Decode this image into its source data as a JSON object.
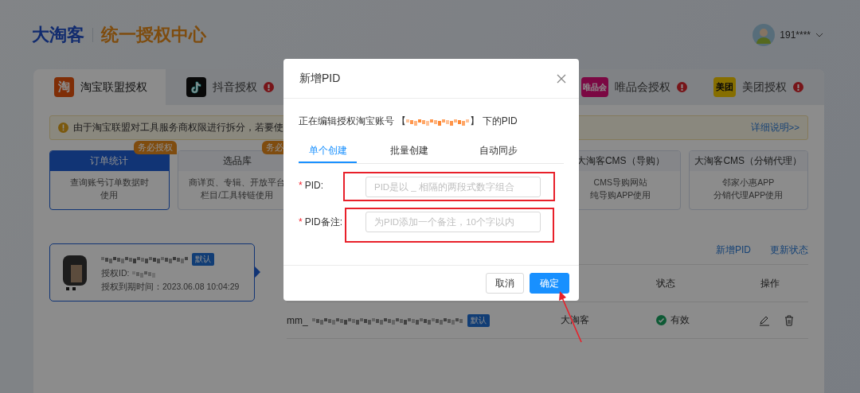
{
  "header": {
    "brand": "大淘客",
    "title": "统一授权中心",
    "user": {
      "name": "191****"
    }
  },
  "tabs": [
    {
      "label": "淘宝联盟授权",
      "selected": true,
      "alert": false,
      "icon": {
        "kind": "taobao",
        "text": "淘"
      }
    },
    {
      "label": "抖音授权",
      "selected": false,
      "alert": true,
      "icon": {
        "kind": "douyin"
      }
    },
    {
      "kind": "hidden"
    },
    {
      "kind": "hidden"
    },
    {
      "label": "唯品会授权",
      "selected": false,
      "alert": true,
      "icon": {
        "kind": "vip",
        "text": "唯品会"
      }
    },
    {
      "label": "美团授权",
      "selected": false,
      "alert": true,
      "icon": {
        "kind": "meituan",
        "text": "美团"
      }
    }
  ],
  "notice": {
    "text": "由于淘宝联盟对工具服务商权限进行拆分，若要使",
    "link": "详细说明>>"
  },
  "features": [
    {
      "title": "订单统计",
      "selected": true,
      "badge": "务必授权",
      "desc": [
        "查询账号订单数据时",
        "使用"
      ]
    },
    {
      "title": "选品库",
      "selected": false,
      "badge": "务必",
      "desc": [
        "商详页、专辑、开放平台",
        "栏目/工具转链使用"
      ]
    },
    {
      "kind": "hidden"
    },
    {
      "kind": "hidden"
    },
    {
      "title": "大淘客CMS（导购）",
      "selected": false,
      "desc": [
        "CMS导购网站",
        "纯导购APP使用"
      ]
    },
    {
      "title": "大淘客CMS（分销代理）",
      "selected": false,
      "desc": [
        "邻家小惠APP",
        "分销代理APP使用"
      ]
    }
  ],
  "account": {
    "tag": "默认",
    "id_label": "授权ID:",
    "expiry": "授权到期时间：2023.06.08 10:04:29",
    "selected": true
  },
  "actions": [
    "新增PID",
    "更新状态"
  ],
  "table": {
    "columns": [
      "",
      "",
      "状态",
      "操作"
    ],
    "rows": [
      {
        "pid_prefix": "mm_",
        "tag": "默认",
        "source": "大淘客",
        "status": "有效",
        "valid": true
      }
    ]
  },
  "dialog": {
    "title": "新增PID",
    "intro_before": "正在编辑授权淘宝账号 【",
    "intro_after": "】 下的PID",
    "tabs": [
      {
        "label": "单个创建",
        "selected": true
      },
      {
        "label": "批量创建",
        "selected": false
      },
      {
        "label": "自动同步",
        "selected": false
      }
    ],
    "fields": [
      {
        "label": "PID:",
        "required_mark": "*",
        "placeholder": "PID是以 _ 相隔的两段式数字组合"
      },
      {
        "label": "PID备注:",
        "required_mark": "*",
        "placeholder": "为PID添加一个备注，10个字以内"
      }
    ],
    "buttons": [
      {
        "label": "取消",
        "primary": false
      },
      {
        "label": "确定",
        "primary": true
      }
    ]
  }
}
